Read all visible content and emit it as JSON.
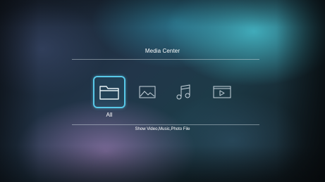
{
  "page": {
    "title": "Media Center",
    "hint": "Show Video,Music,Photo File"
  },
  "categories": [
    {
      "label": "All",
      "icon": "folder-icon",
      "selected": true
    },
    {
      "label": "",
      "icon": "image-icon",
      "selected": false
    },
    {
      "label": "",
      "icon": "music-note-icon",
      "selected": false
    },
    {
      "label": "",
      "icon": "video-play-icon",
      "selected": false
    }
  ],
  "colors": {
    "accent": "#58c8e8",
    "text": "#ffffff"
  }
}
